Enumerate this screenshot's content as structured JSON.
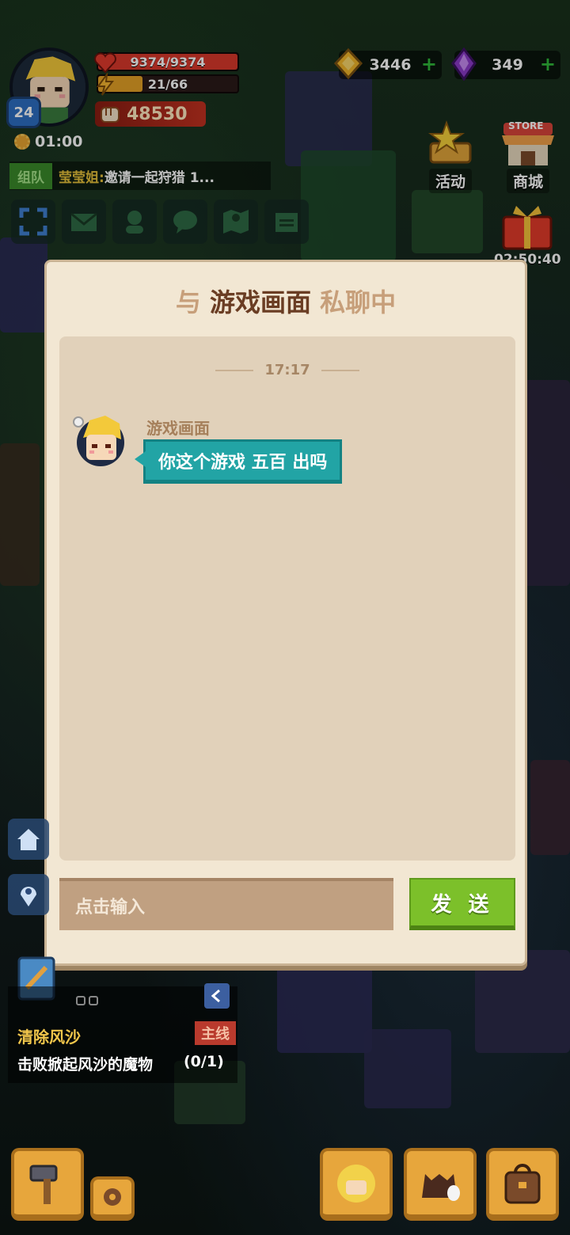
{
  "hud": {
    "level": "24",
    "hp_text": "9374/9374",
    "hp_fraction": 1.0,
    "energy_text": "21/66",
    "energy_fraction": 0.318,
    "power": "48530",
    "timer": "01:00",
    "team": {
      "tag": "组队",
      "name": "莹莹姐:",
      "message": "邀请一起狩猎 1..."
    },
    "gold": "3446",
    "gems": "349",
    "events_label": "活动",
    "store_label": "商城",
    "store_sign": "STORE",
    "gift_timer": "02:50:40"
  },
  "chat": {
    "title_prefix": "与",
    "title_name": "游戏画面",
    "title_suffix": "私聊中",
    "timestamp": "17:17",
    "messages": [
      {
        "sender": "游戏画面",
        "text": "你这个游戏 五百 出吗"
      }
    ],
    "input_placeholder": "点击输入",
    "send_label": "发 送"
  },
  "quest": {
    "title": "清除风沙",
    "tag": "主线",
    "description": "击败掀起风沙的魔物",
    "progress": "(0/1)"
  },
  "colors": {
    "teal_bubble": "#22a4a5",
    "send_green": "#7cc02a",
    "dialog_bg": "#f2e7d3",
    "title_brown": "#6a3d23"
  },
  "icons": [
    "fullscreen-icon",
    "mail-icon",
    "friends-icon",
    "chat-icon",
    "map-icon",
    "notice-icon",
    "home-icon",
    "location-icon",
    "hammer-icon",
    "settings-icon",
    "pet-icon",
    "bag-icon"
  ]
}
